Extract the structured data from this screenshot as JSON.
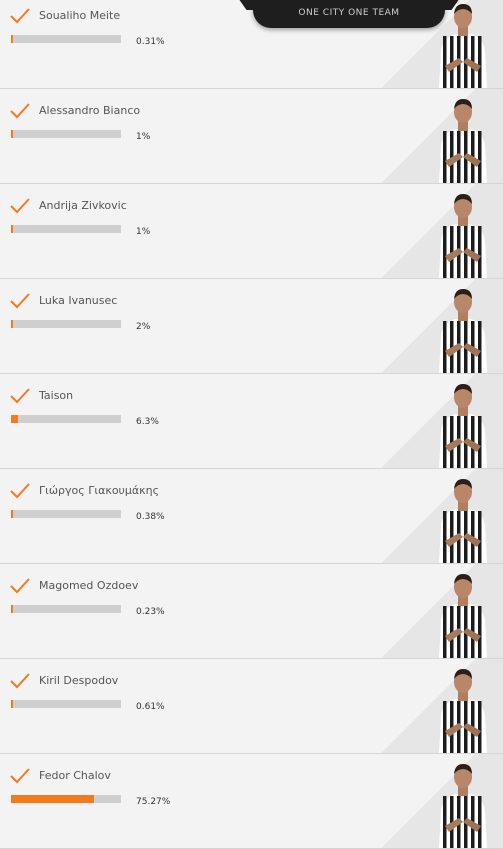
{
  "banner": {
    "text": "ONE CITY ONE TEAM"
  },
  "accent_color": "#f47a1f",
  "players": [
    {
      "name": "Soualiho Meite",
      "percent_label": "0.31%",
      "percent": 0.31
    },
    {
      "name": "Alessandro Bianco",
      "percent_label": "1%",
      "percent": 1
    },
    {
      "name": "Andrija Zivkovic",
      "percent_label": "1%",
      "percent": 1
    },
    {
      "name": "Luka Ivanusec",
      "percent_label": "2%",
      "percent": 2
    },
    {
      "name": "Taison",
      "percent_label": "6.3%",
      "percent": 6.3
    },
    {
      "name": "Γιώργος Γιακουμάκης",
      "percent_label": "0.38%",
      "percent": 0.38
    },
    {
      "name": "Magomed Ozdoev",
      "percent_label": "0.23%",
      "percent": 0.23
    },
    {
      "name": "Kiril Despodov",
      "percent_label": "0.61%",
      "percent": 0.61
    },
    {
      "name": "Fedor Chalov",
      "percent_label": "75.27%",
      "percent": 75.27
    }
  ],
  "icons": {
    "vote": "checkmark-icon",
    "player": "player-photo"
  }
}
